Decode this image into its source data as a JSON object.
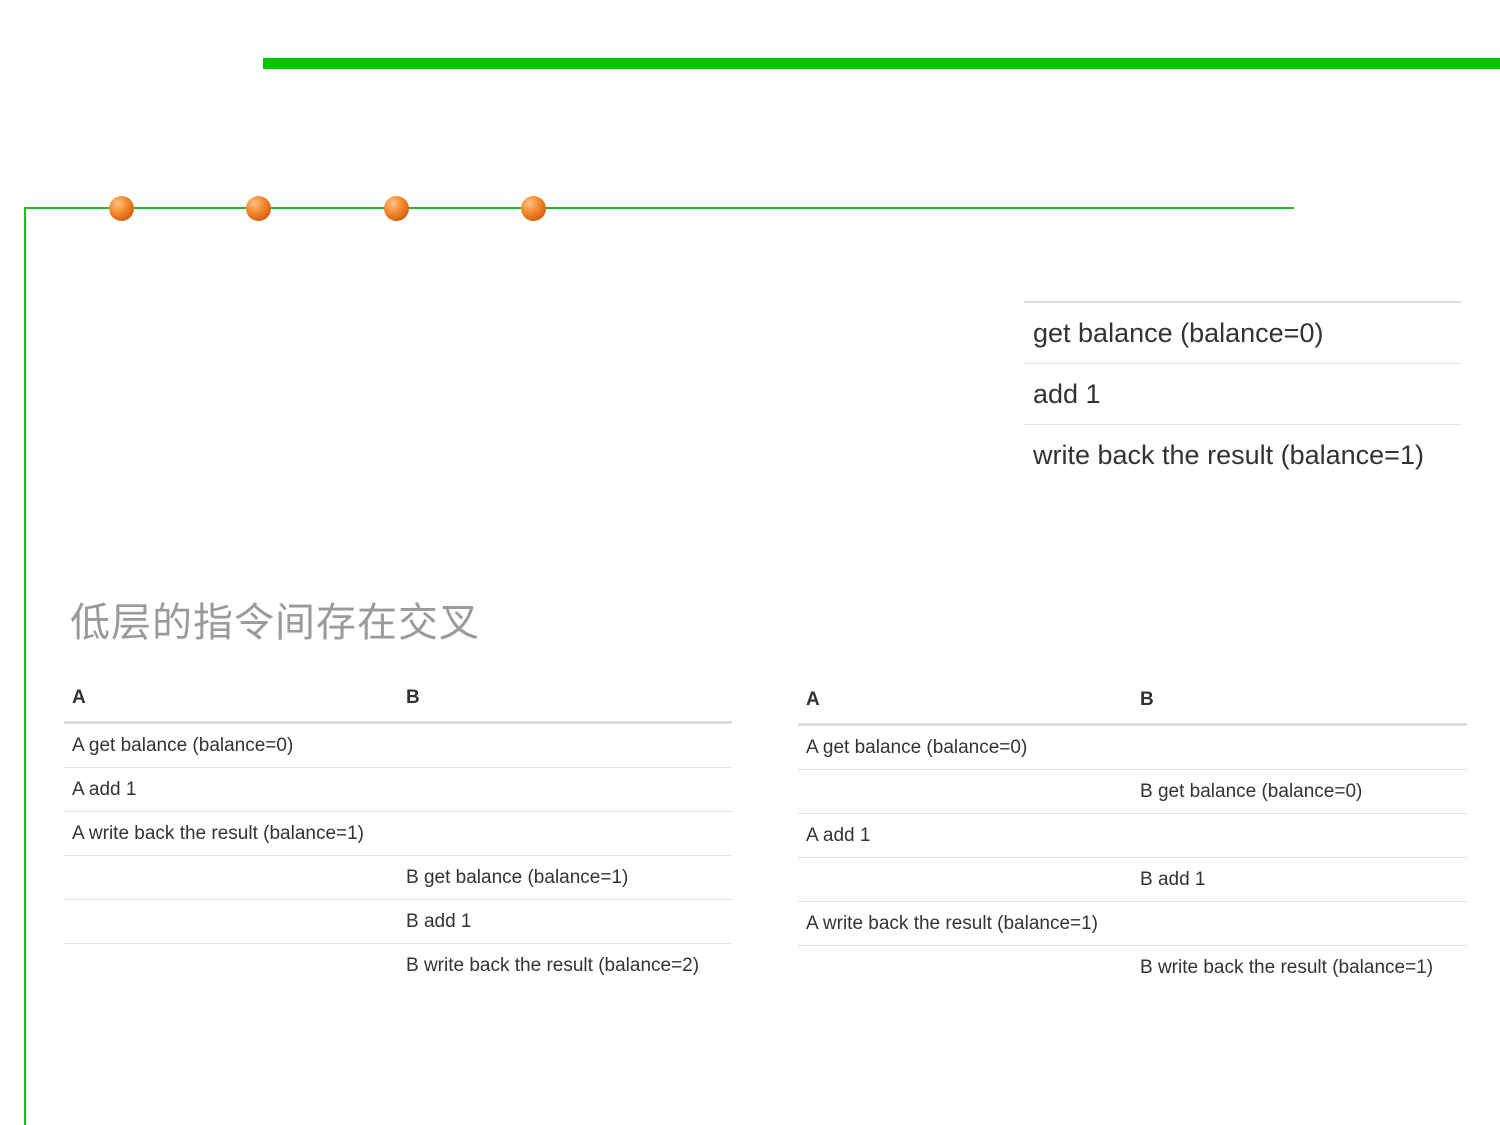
{
  "steps": [
    "get balance (balance=0)",
    "add 1",
    "write back the result (balance=1)"
  ],
  "heading": "低层的指令间存在交叉",
  "left_table": {
    "headers": [
      "A",
      "B"
    ],
    "rows": [
      [
        "A get balance (balance=0)",
        ""
      ],
      [
        "A add 1",
        ""
      ],
      [
        "A write back the result (balance=1)",
        ""
      ],
      [
        "",
        "B get balance (balance=1)"
      ],
      [
        "",
        "B add 1"
      ],
      [
        "",
        "B write back the result (balance=2)"
      ]
    ]
  },
  "right_table": {
    "headers": [
      "A",
      "B"
    ],
    "rows": [
      [
        "A get balance (balance=0)",
        ""
      ],
      [
        "",
        "B get balance (balance=0)"
      ],
      [
        "A add 1",
        ""
      ],
      [
        "",
        "B add 1"
      ],
      [
        "A write back the result (balance=1)",
        ""
      ],
      [
        "",
        "B write back the result (balance=1)"
      ]
    ]
  },
  "colors": {
    "top_bar": "#00c800",
    "frame_line": "#22bb22",
    "bullet": "#f38a2c",
    "heading_text": "#9a9a9a"
  }
}
